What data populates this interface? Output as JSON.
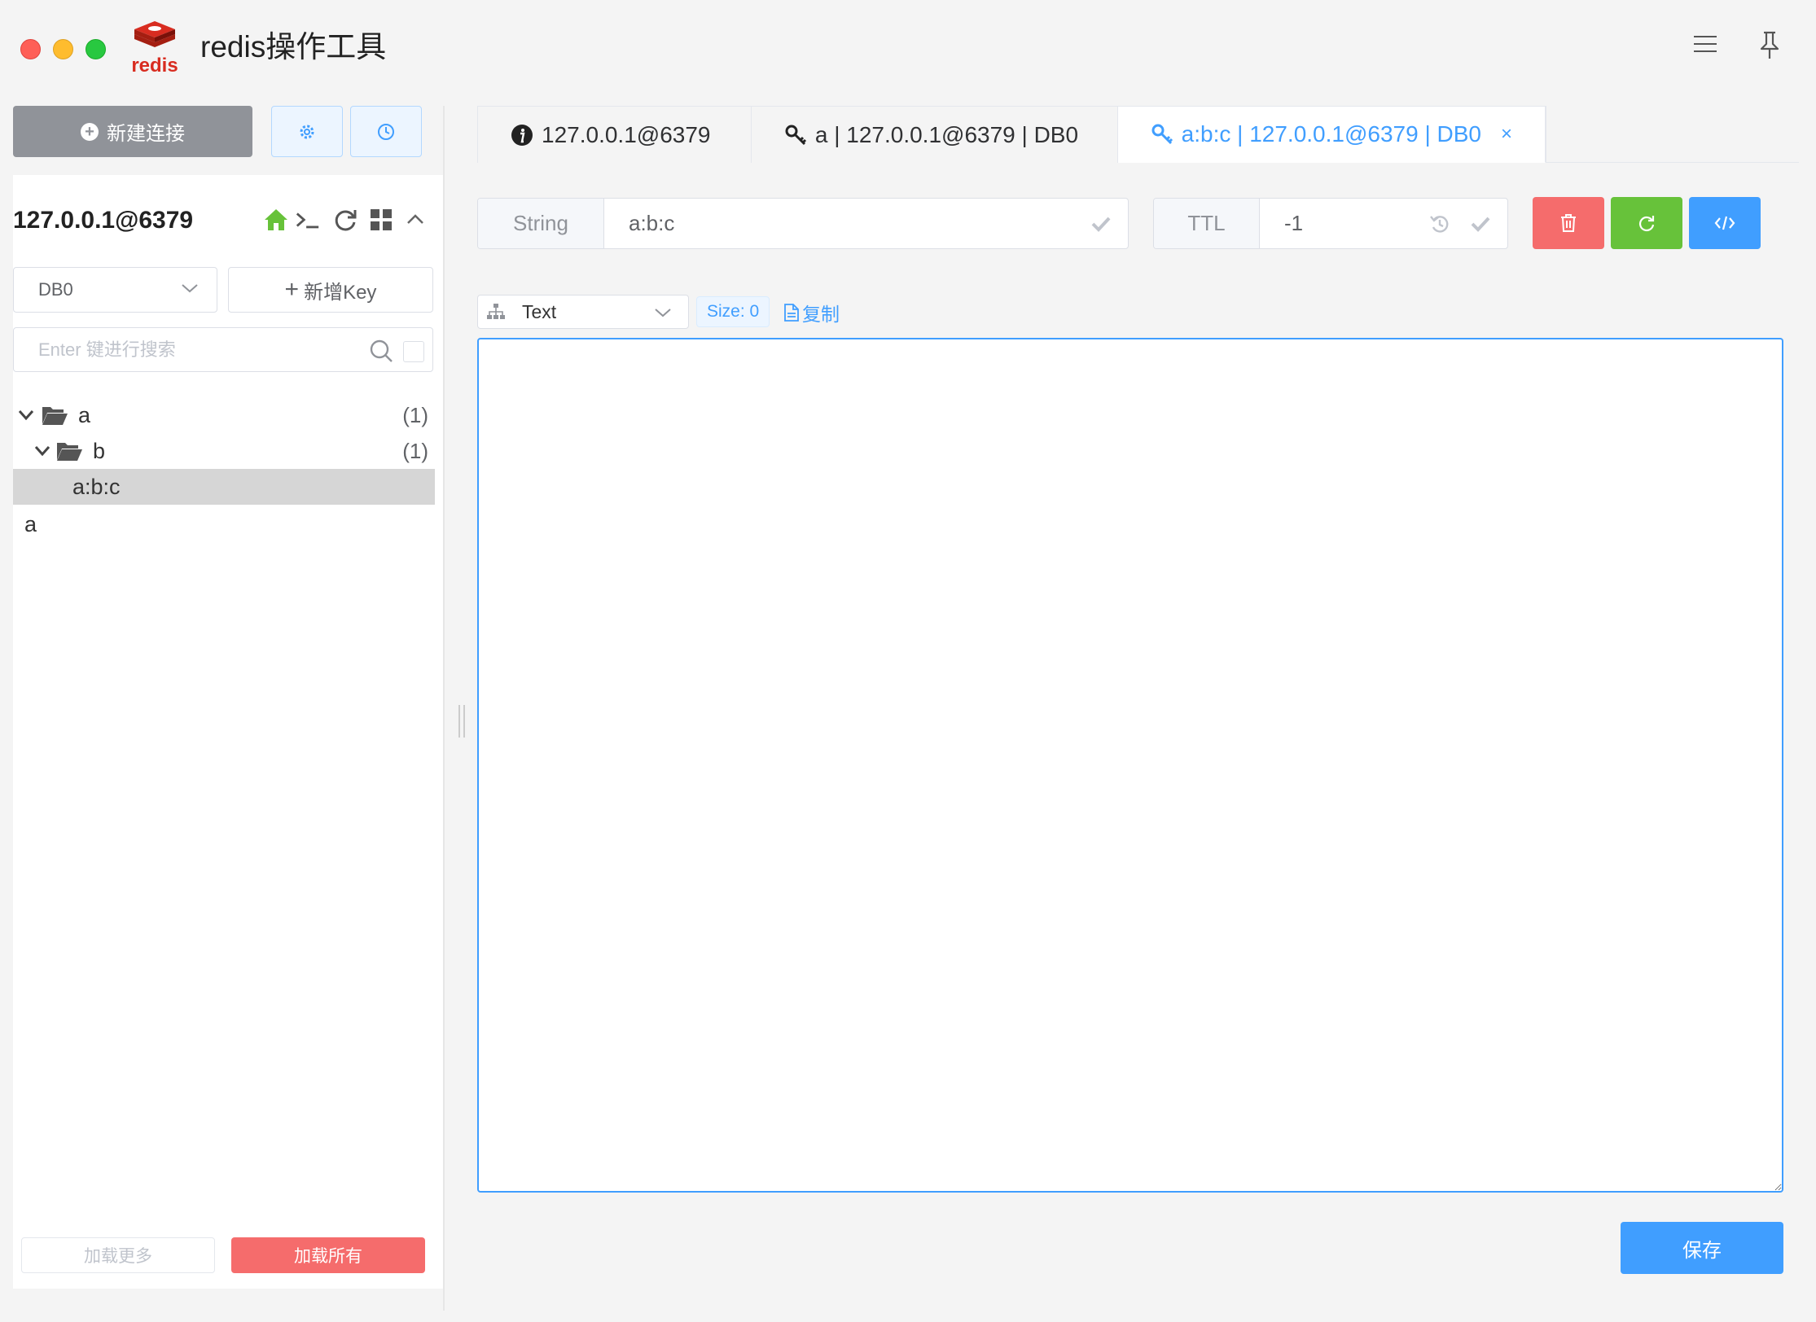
{
  "app": {
    "title": "redis操作工具",
    "logo_text": "redis"
  },
  "sidebar": {
    "new_connection_label": "新建连接",
    "connection": {
      "name": "127.0.0.1@6379"
    },
    "db_select": {
      "value": "DB0"
    },
    "add_key_label": "新增Key",
    "search": {
      "placeholder": "Enter 键进行搜索",
      "value": ""
    },
    "tree": [
      {
        "label": "a",
        "count": "(1)",
        "type": "folder"
      },
      {
        "label": "b",
        "count": "(1)",
        "type": "folder"
      },
      {
        "label": "a:b:c",
        "count": "",
        "type": "key",
        "selected": true
      },
      {
        "label": "a",
        "count": "",
        "type": "key"
      }
    ],
    "load_more_label": "加载更多",
    "load_all_label": "加载所有"
  },
  "tabs": [
    {
      "label": "127.0.0.1@6379",
      "icon": "info-icon"
    },
    {
      "label": "a | 127.0.0.1@6379 | DB0",
      "icon": "key-icon"
    },
    {
      "label": "a:b:c | 127.0.0.1@6379 | DB0",
      "icon": "key-icon",
      "active": true
    }
  ],
  "key_detail": {
    "type": "String",
    "name": "a:b:c",
    "ttl_label": "TTL",
    "ttl_value": "-1",
    "format": "Text",
    "size_label": "Size: 0",
    "copy_label": "复制",
    "value": "",
    "save_label": "保存"
  },
  "colors": {
    "accent": "#409eff",
    "danger": "#f56c6c",
    "success": "#67c23a",
    "home_icon": "#67c23a"
  }
}
